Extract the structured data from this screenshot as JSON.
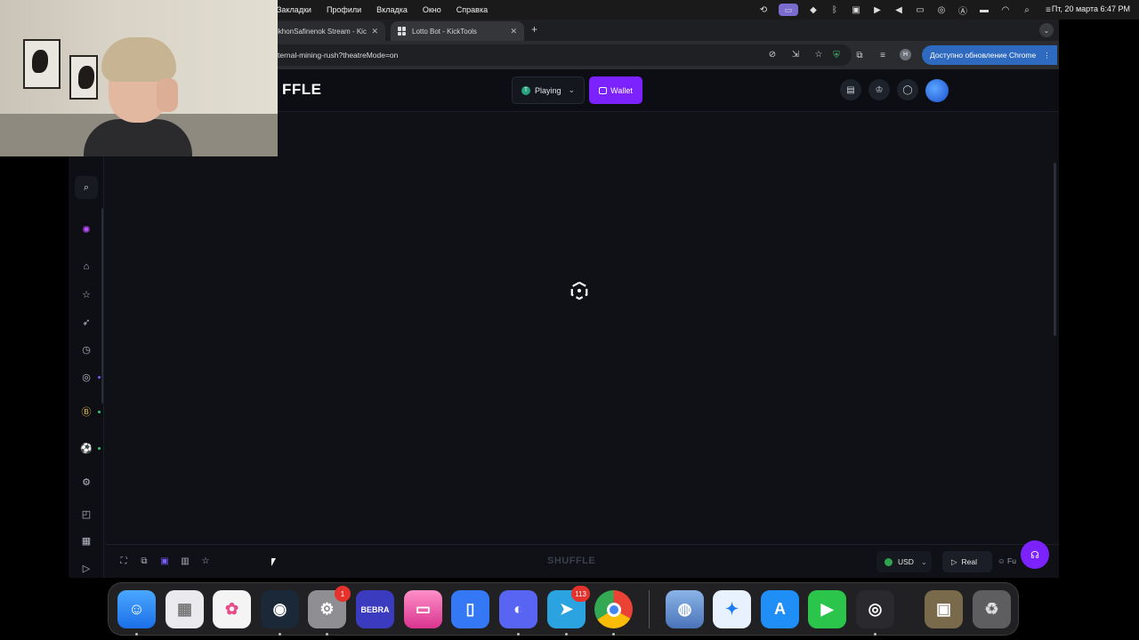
{
  "menubar": {
    "menus": [
      "Закладки",
      "Профили",
      "Вкладка",
      "Окно",
      "Справка"
    ],
    "clock": "Пт, 20 марта  6:47 PM"
  },
  "tabs": [
    {
      "label": "ikhonSafinenok Stream - Kic"
    },
    {
      "label": "Lotto Bot - KickTools"
    }
  ],
  "address_bar": {
    "url": "ternal-mining-rush?theatreMode=on",
    "profile_initial": "H",
    "update_label": "Доступно обновление Chrome"
  },
  "site": {
    "logo": "FFLE",
    "playing_label": "Playing",
    "playing_coin": "T",
    "wallet_label": "Wallet",
    "footer_brand": "SHUFFLE",
    "currency_label": "USD",
    "mode_real_label": "Real",
    "mode_fun_label": "Fu"
  },
  "dock": {
    "bebra_label": "BEBRA",
    "settings_badge": "1",
    "telegram_badge": "113"
  },
  "colors": {
    "accent": "#7b22ff",
    "page_bg": "#0f1117",
    "update_button": "#2e6ac0"
  }
}
